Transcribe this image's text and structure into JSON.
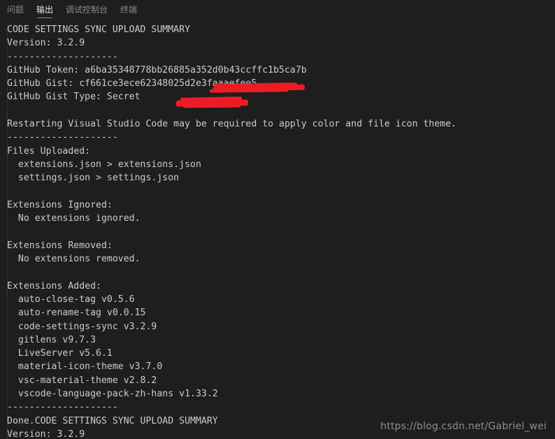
{
  "panel": {
    "tabs": [
      {
        "label": "问题",
        "active": false
      },
      {
        "label": "输出",
        "active": true
      },
      {
        "label": "调试控制台",
        "active": false
      },
      {
        "label": "终端",
        "active": false
      }
    ]
  },
  "output": {
    "lines": [
      "CODE SETTINGS SYNC UPLOAD SUMMARY",
      "Version: 3.2.9",
      "--------------------",
      "GitHub Token: a6ba35348778bb26885a352d0b43ccffc1b5ca7b",
      "GitHub Gist: cf661ce3ece62348025d2e3faaaefee5",
      "GitHub Gist Type: Secret",
      "",
      "Restarting Visual Studio Code may be required to apply color and file icon theme.",
      "--------------------",
      "Files Uploaded:",
      "  extensions.json > extensions.json",
      "  settings.json > settings.json",
      "",
      "Extensions Ignored:",
      "  No extensions ignored.",
      "",
      "Extensions Removed:",
      "  No extensions removed.",
      "",
      "Extensions Added:",
      "  auto-close-tag v0.5.6",
      "  auto-rename-tag v0.0.15",
      "  code-settings-sync v3.2.9",
      "  gitlens v9.7.3",
      "  LiveServer v5.6.1",
      "  material-icon-theme v3.7.0",
      "  vsc-material-theme v2.8.2",
      "  vscode-language-pack-zh-hans v1.33.2",
      "--------------------",
      "Done.CODE SETTINGS SYNC UPLOAD SUMMARY",
      "Version: 3.2.9"
    ]
  },
  "watermark": {
    "text": "https://blog.csdn.net/Gabriel_wei"
  },
  "colors": {
    "background": "#1e1e1e",
    "text": "#cccccc",
    "tab_active": "#e7e7e7",
    "tab_inactive": "#8a8a8a",
    "redaction": "#ed1c24",
    "watermark": "#8e8e8e"
  }
}
